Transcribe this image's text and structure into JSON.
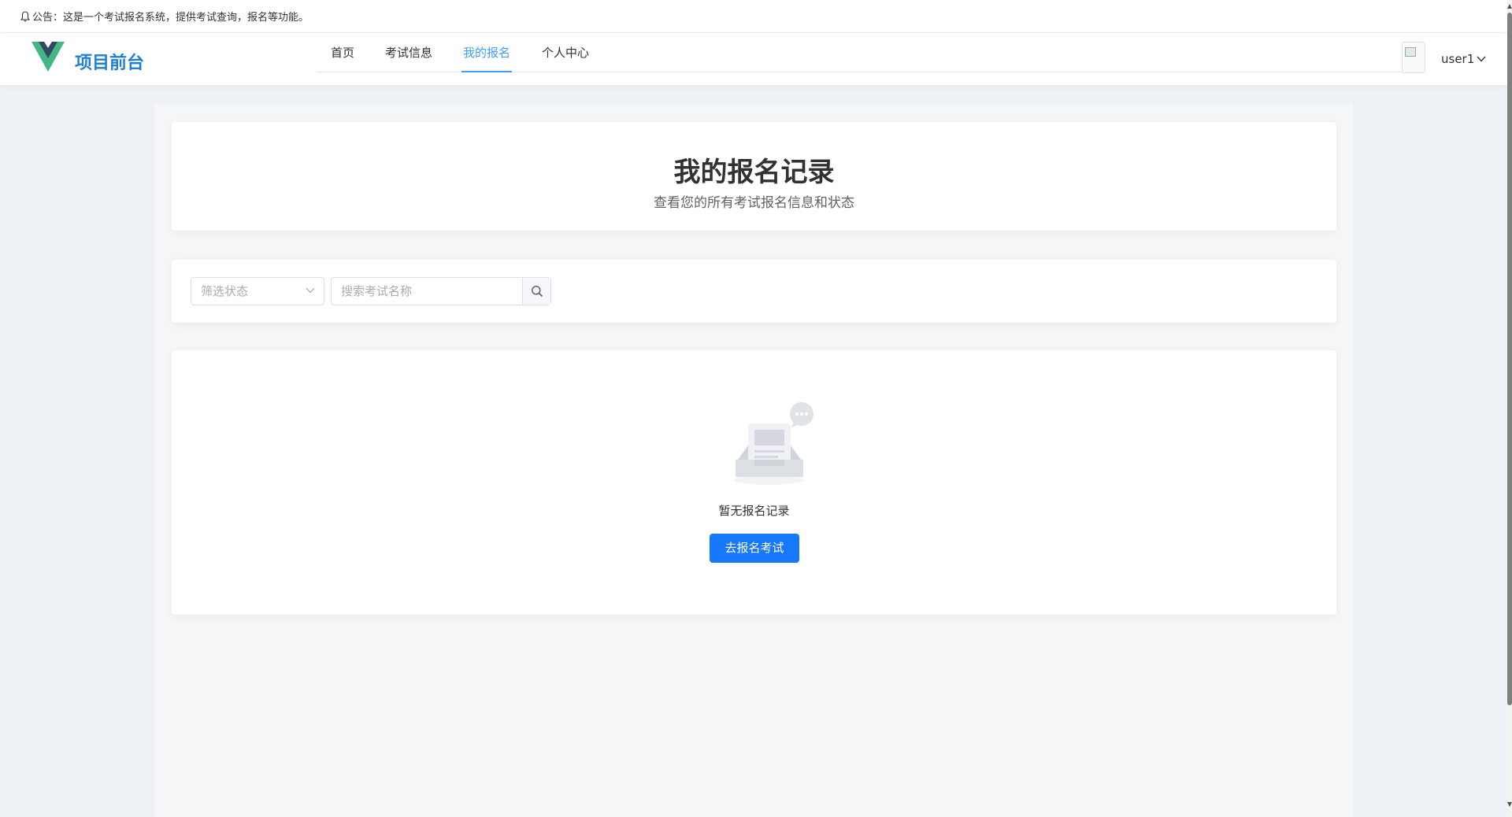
{
  "announcement": "公告：这是一个考试报名系统，提供考试查询，报名等功能。",
  "brand": {
    "name": "项目前台",
    "logo_color_outer": "#41b883",
    "logo_color_inner": "#35495e"
  },
  "nav": {
    "items": [
      {
        "label": "首页",
        "active": false
      },
      {
        "label": "考试信息",
        "active": false
      },
      {
        "label": "我的报名",
        "active": true
      },
      {
        "label": "个人中心",
        "active": false
      }
    ]
  },
  "user": {
    "name": "user1"
  },
  "page": {
    "title": "我的报名记录",
    "subtitle": "查看您的所有考试报名信息和状态"
  },
  "filters": {
    "status_placeholder": "筛选状态",
    "search_placeholder": "搜索考试名称"
  },
  "empty": {
    "text": "暂无报名记录",
    "button": "去报名考试"
  },
  "colors": {
    "accent": "#409eff",
    "primary_button": "#1677ff"
  }
}
